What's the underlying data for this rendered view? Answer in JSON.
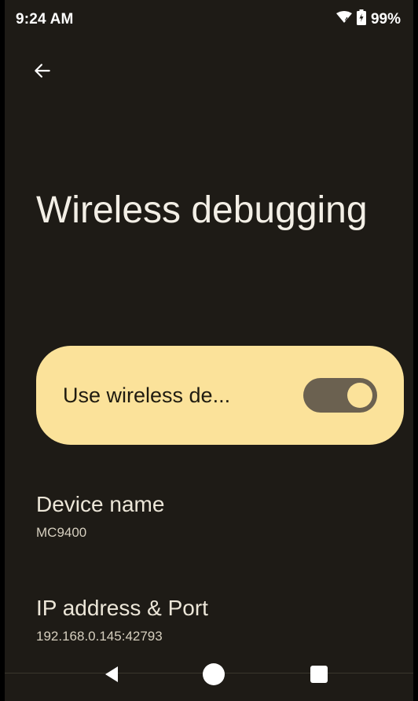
{
  "status_bar": {
    "time": "9:24 AM",
    "battery": "99%",
    "icons": [
      "wifi-icon",
      "battery-icon"
    ]
  },
  "header": {
    "back_icon": "back-arrow-icon",
    "title": "Wireless debugging"
  },
  "toggle": {
    "label": "Use wireless de...",
    "checked": true
  },
  "preferences": [
    {
      "title": "Device name",
      "summary": "MC9400"
    },
    {
      "title": "IP address & Port",
      "summary": "192.168.0.145:42793"
    }
  ],
  "navigation": {
    "back_icon": "nav-back-icon",
    "home_icon": "nav-home-icon",
    "recents_icon": "nav-recents-icon"
  },
  "colors": {
    "background": "#1e1b16",
    "toggle_card": "#fbe29a",
    "switch_track": "#6b6150",
    "text_primary": "#f3efe6"
  }
}
